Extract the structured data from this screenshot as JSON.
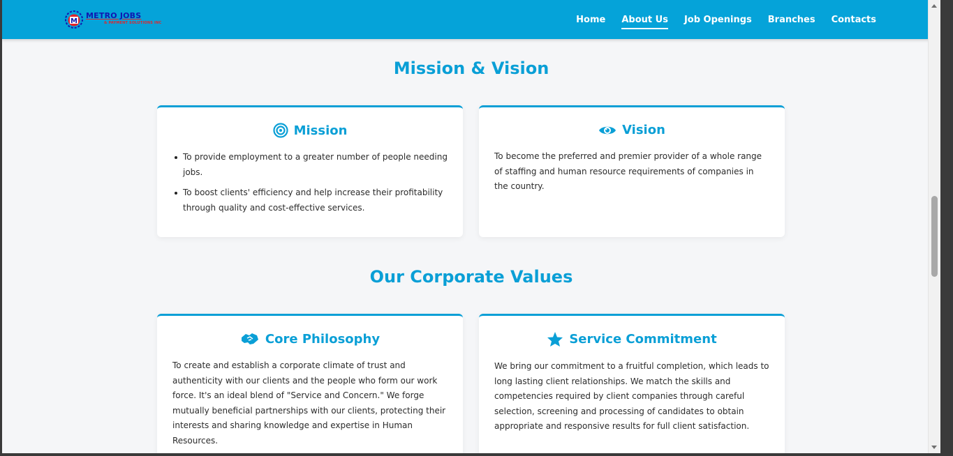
{
  "brand": {
    "title": "METRO JOBS",
    "subtitle": "& PAYMENT SOLUTIONS INC",
    "badge_letter": "M",
    "colors": {
      "primary": "#05a3d9",
      "logo_blue": "#1018b0",
      "logo_red": "#e2242a"
    }
  },
  "nav": {
    "items": [
      {
        "label": "Home",
        "active": false
      },
      {
        "label": "About Us",
        "active": true
      },
      {
        "label": "Job Openings",
        "active": false
      },
      {
        "label": "Branches",
        "active": false
      },
      {
        "label": "Contacts",
        "active": false
      }
    ]
  },
  "mission_vision": {
    "title": "Mission & Vision",
    "mission": {
      "icon": "bullseye-icon",
      "title": "Mission",
      "points": [
        "To provide employment to a greater number of people needing jobs.",
        "To boost clients' efficiency and help increase their profitability through quality and cost-effective services."
      ]
    },
    "vision": {
      "icon": "eye-icon",
      "title": "Vision",
      "text": "To become the preferred and premier provider of a whole range of staffing and human resource requirements of companies in the country."
    }
  },
  "values": {
    "title": "Our Corporate Values",
    "core": {
      "icon": "handshake-icon",
      "title": "Core Philosophy",
      "text": "To create and establish a corporate climate of trust and authenticity with our clients and the people who form our work force. It's an ideal blend of \"Service and Concern.\" We forge mutually beneficial partnerships with our clients, protecting their interests and sharing knowledge and expertise in Human Resources."
    },
    "service": {
      "icon": "star-icon",
      "title": "Service Commitment",
      "text": "We bring our commitment to a fruitful completion, which leads to long lasting client relationships. We match the skills and competencies required by client companies through careful selection, screening and processing of candidates to obtain appropriate and responsive results for full client satisfaction."
    }
  }
}
